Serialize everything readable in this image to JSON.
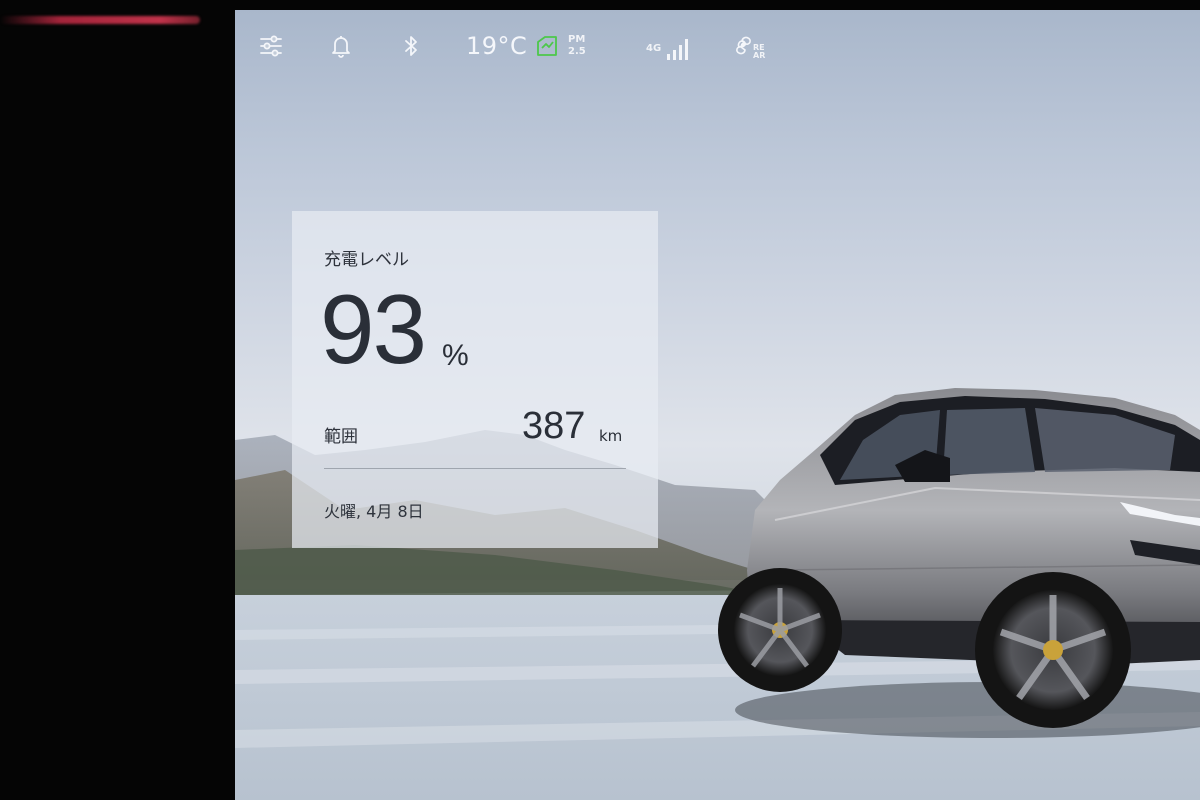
{
  "status_bar": {
    "temperature": "19°C",
    "air_quality_line1": "PM",
    "air_quality_line2": "2.5",
    "network": "4G",
    "rear_line1": "RE",
    "rear_line2": "AR",
    "icons": [
      "settings-sliders-icon",
      "bell-icon",
      "bluetooth-icon",
      "air-quality-icon",
      "signal-icon",
      "rear-fan-icon"
    ],
    "aqi_color": "#4cc84a"
  },
  "card": {
    "title": "充電レベル",
    "battery_value": "93",
    "battery_unit": "%",
    "battery_level_percent": 93,
    "range_label": "範囲",
    "range_value": "387",
    "range_unit": "km",
    "date": "火曜, 4月 8日"
  },
  "colors": {
    "accent_glow": "#c0334a",
    "text_dark": "#2a2f38"
  }
}
